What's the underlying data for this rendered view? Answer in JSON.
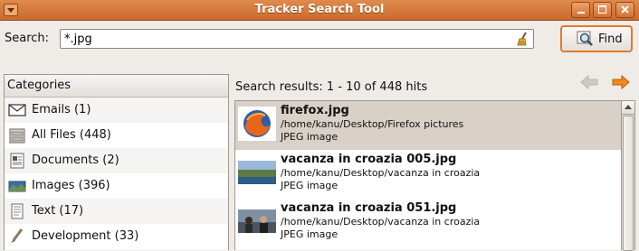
{
  "window": {
    "title": "Tracker Search Tool",
    "accent_color": "#d9793a"
  },
  "search": {
    "label": "Search:",
    "value": "*.jpg",
    "find_label": "Find"
  },
  "categories": {
    "header": "Categories",
    "items": [
      {
        "label": "Emails (1)",
        "icon": "envelope-icon"
      },
      {
        "label": "All Files (448)",
        "icon": "file-cabinet-icon"
      },
      {
        "label": "Documents (2)",
        "icon": "document-icon"
      },
      {
        "label": "Images (396)",
        "icon": "image-icon"
      },
      {
        "label": "Text (17)",
        "icon": "text-file-icon"
      },
      {
        "label": "Development (33)",
        "icon": "development-icon"
      }
    ]
  },
  "results": {
    "summary": "Search results: 1 - 10 of 448 hits",
    "items": [
      {
        "name": "firefox.jpg",
        "path": "/home/kanu/Desktop/Firefox pictures",
        "type": "JPEG image"
      },
      {
        "name": "vacanza in croazia 005.jpg",
        "path": "/home/kanu/Desktop/vacanza in croazia",
        "type": "JPEG image"
      },
      {
        "name": "vacanza in croazia 051.jpg",
        "path": "/home/kanu/Desktop/vacanza in croazia",
        "type": "JPEG image"
      }
    ]
  }
}
